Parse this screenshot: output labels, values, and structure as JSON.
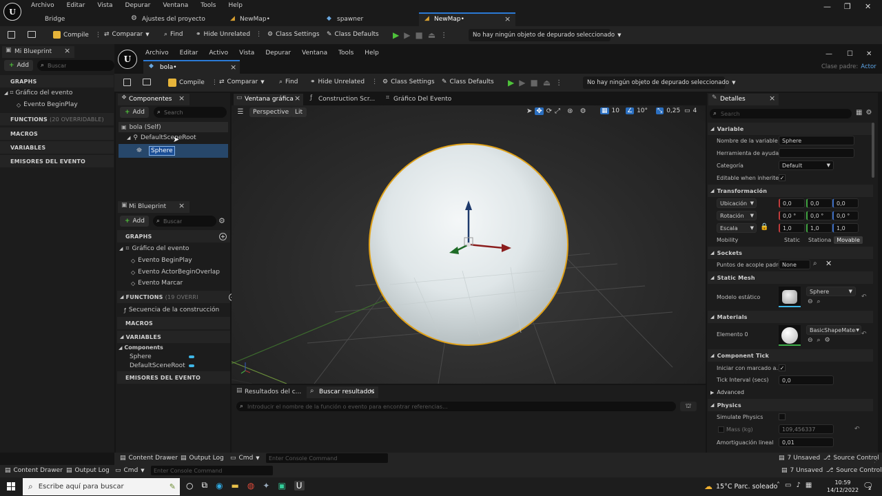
{
  "outer_menu": {
    "items": [
      "Archivo",
      "Editar",
      "Vista",
      "Depurar",
      "Ventana",
      "Tools",
      "Help"
    ]
  },
  "outer_tabs": [
    {
      "label": "Bridge"
    },
    {
      "label": "Ajustes del proyecto"
    },
    {
      "label": "NewMap•"
    },
    {
      "label": "spawner"
    },
    {
      "label": "NewMap•",
      "close": "×"
    }
  ],
  "outer_toolbar": {
    "compile": "Compile",
    "comparar": "Comparar",
    "find": "Find",
    "hide_unrelated": "Hide Unrelated",
    "class_settings": "Class Settings",
    "class_defaults": "Class Defaults",
    "debug_select": "No hay ningún objeto de depurado seleccionado"
  },
  "outer_left": {
    "tab": "Mi Blueprint",
    "tab_close": "×",
    "add": "Add",
    "search_placeholder": "Buscar",
    "graphs": "GRAPHS",
    "grafico": "Gráfico del evento",
    "begin_play": "Evento BeginPlay",
    "functions": "FUNCTIONS",
    "functions_count": "(20 OVERRIDABLE)",
    "macros": "MACROS",
    "variables": "VARIABLES",
    "emisores": "EMISORES DEL EVENTO"
  },
  "inner": {
    "menu": [
      "Archivo",
      "Editar",
      "Activo",
      "Vista",
      "Depurar",
      "Ventana",
      "Tools",
      "Help"
    ],
    "doc_tab": "bola•",
    "doc_close": "×",
    "parent_label": "Clase padre:",
    "parent_value": "Actor",
    "toolbar": {
      "compile": "Compile",
      "comparar": "Comparar",
      "find": "Find",
      "hide_unrelated": "Hide Unrelated",
      "class_settings": "Class Settings",
      "class_defaults": "Class Defaults",
      "debug_select": "No hay ningún objeto de depurado seleccionado"
    }
  },
  "components": {
    "tab": "Componentes",
    "tab_close": "×",
    "add": "Add",
    "search_placeholder": "Search",
    "self": "bola (Self)",
    "root": "DefaultSceneRoot",
    "sphere": "Sphere"
  },
  "my_blueprint": {
    "tab": "Mi Blueprint",
    "tab_close": "×",
    "add": "Add",
    "search_placeholder": "Buscar",
    "graphs": "GRAPHS",
    "grafico": "Gráfico del evento",
    "events": [
      "Evento BeginPlay",
      "Evento ActorBeginOverlap",
      "Evento Marcar"
    ],
    "functions": "FUNCTIONS",
    "functions_count": "(19 OVERRI",
    "construction": "Secuencia de la construcción",
    "macros": "MACROS",
    "variables": "VARIABLES",
    "components_cat": "Components",
    "vars": [
      "Sphere",
      "DefaultSceneRoot"
    ],
    "emisores": "EMISORES DEL EVENTO"
  },
  "viewport": {
    "tabs": [
      {
        "label": "Ventana gráfica",
        "close": "×"
      },
      {
        "label": "Construction Scr..."
      },
      {
        "label": "Gráfico Del Evento"
      }
    ],
    "perspective": "Perspective",
    "lit": "Lit",
    "grid_snap": "10",
    "rot_snap": "10°",
    "scale_snap": "0,25",
    "cam_speed": "4"
  },
  "results": {
    "tab1": "Resultados del c...",
    "tab2": "Buscar resultados",
    "tab2_close": "×",
    "search_placeholder": "Introducir el nombre de la función o evento para encontrar referencias..."
  },
  "details": {
    "tab": "Detalles",
    "tab_close": "×",
    "search_placeholder": "Search",
    "variable": {
      "header": "Variable",
      "name_label": "Nombre de la variable",
      "name_value": "Sphere",
      "tooltip_label": "Herramienta de ayuda",
      "tooltip_value": "",
      "category_label": "Categoría",
      "category_value": "Default",
      "editable_label": "Editable when inherited"
    },
    "transform": {
      "header": "Transformación",
      "location_label": "Ubicación",
      "location": [
        "0,0",
        "0,0",
        "0,0"
      ],
      "rotation_label": "Rotación",
      "rotation": [
        "0,0 °",
        "0,0 °",
        "0,0 °"
      ],
      "scale_label": "Escala",
      "scale": [
        "1,0",
        "1,0",
        "1,0"
      ],
      "mobility_label": "Mobility",
      "mobility_options": [
        "Static",
        "Stationa",
        "Movable"
      ]
    },
    "sockets": {
      "header": "Sockets",
      "parent_label": "Puntos de acople padre",
      "parent_value": "None"
    },
    "static_mesh": {
      "header": "Static Mesh",
      "label": "Modelo estático",
      "value": "Sphere"
    },
    "materials": {
      "header": "Materials",
      "label": "Elemento 0",
      "value": "BasicShapeMaterial"
    },
    "tick": {
      "header": "Component Tick",
      "start_label": "Iniciar con marcado a...",
      "interval_label": "Tick Interval (secs)",
      "interval_value": "0,0",
      "advanced": "Advanced"
    },
    "physics": {
      "header": "Physics",
      "simulate_label": "Simulate Physics",
      "mass_label": "Mass (kg)",
      "mass_value": "109,456337",
      "damping_label": "Amortiguación lineal",
      "damping_value": "0,01"
    }
  },
  "inner_bottom": {
    "content_drawer": "Content Drawer",
    "output_log": "Output Log",
    "cmd": "Cmd",
    "console_placeholder": "Enter Console Command",
    "unsaved": "7 Unsaved",
    "source_control": "Source Control"
  },
  "outer_bottom": {
    "content_drawer": "Content Drawer",
    "output_log": "Output Log",
    "cmd": "Cmd",
    "console_placeholder": "Enter Console Command",
    "unsaved": "7 Unsaved",
    "source_control": "Source Control"
  },
  "taskbar": {
    "search_placeholder": "Escribe aquí para buscar",
    "weather": "15°C  Parc. soleado",
    "time": "10:59",
    "date": "14/12/2022",
    "notif_count": "2"
  }
}
